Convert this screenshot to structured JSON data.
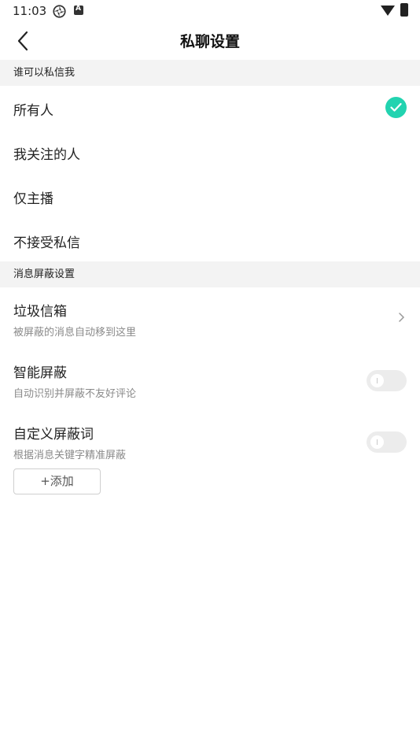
{
  "status_bar": {
    "time": "11:03"
  },
  "header": {
    "title": "私聊设置"
  },
  "section_who": {
    "title": "谁可以私信我",
    "options": [
      {
        "label": "所有人",
        "selected": true
      },
      {
        "label": "我关注的人",
        "selected": false
      },
      {
        "label": "仅主播",
        "selected": false
      },
      {
        "label": "不接受私信",
        "selected": false
      }
    ]
  },
  "section_block": {
    "title": "消息屏蔽设置",
    "trash": {
      "title": "垃圾信箱",
      "subtitle": "被屏蔽的消息自动移到这里"
    },
    "smart": {
      "title": "智能屏蔽",
      "subtitle": "自动识别并屏蔽不友好评论",
      "enabled": false
    },
    "custom": {
      "title": "自定义屏蔽词",
      "subtitle": "根据消息关键字精准屏蔽",
      "enabled": false,
      "add_label": "+添加"
    }
  },
  "colors": {
    "accent": "#22d3b0",
    "section_bg": "#f3f3f3"
  }
}
